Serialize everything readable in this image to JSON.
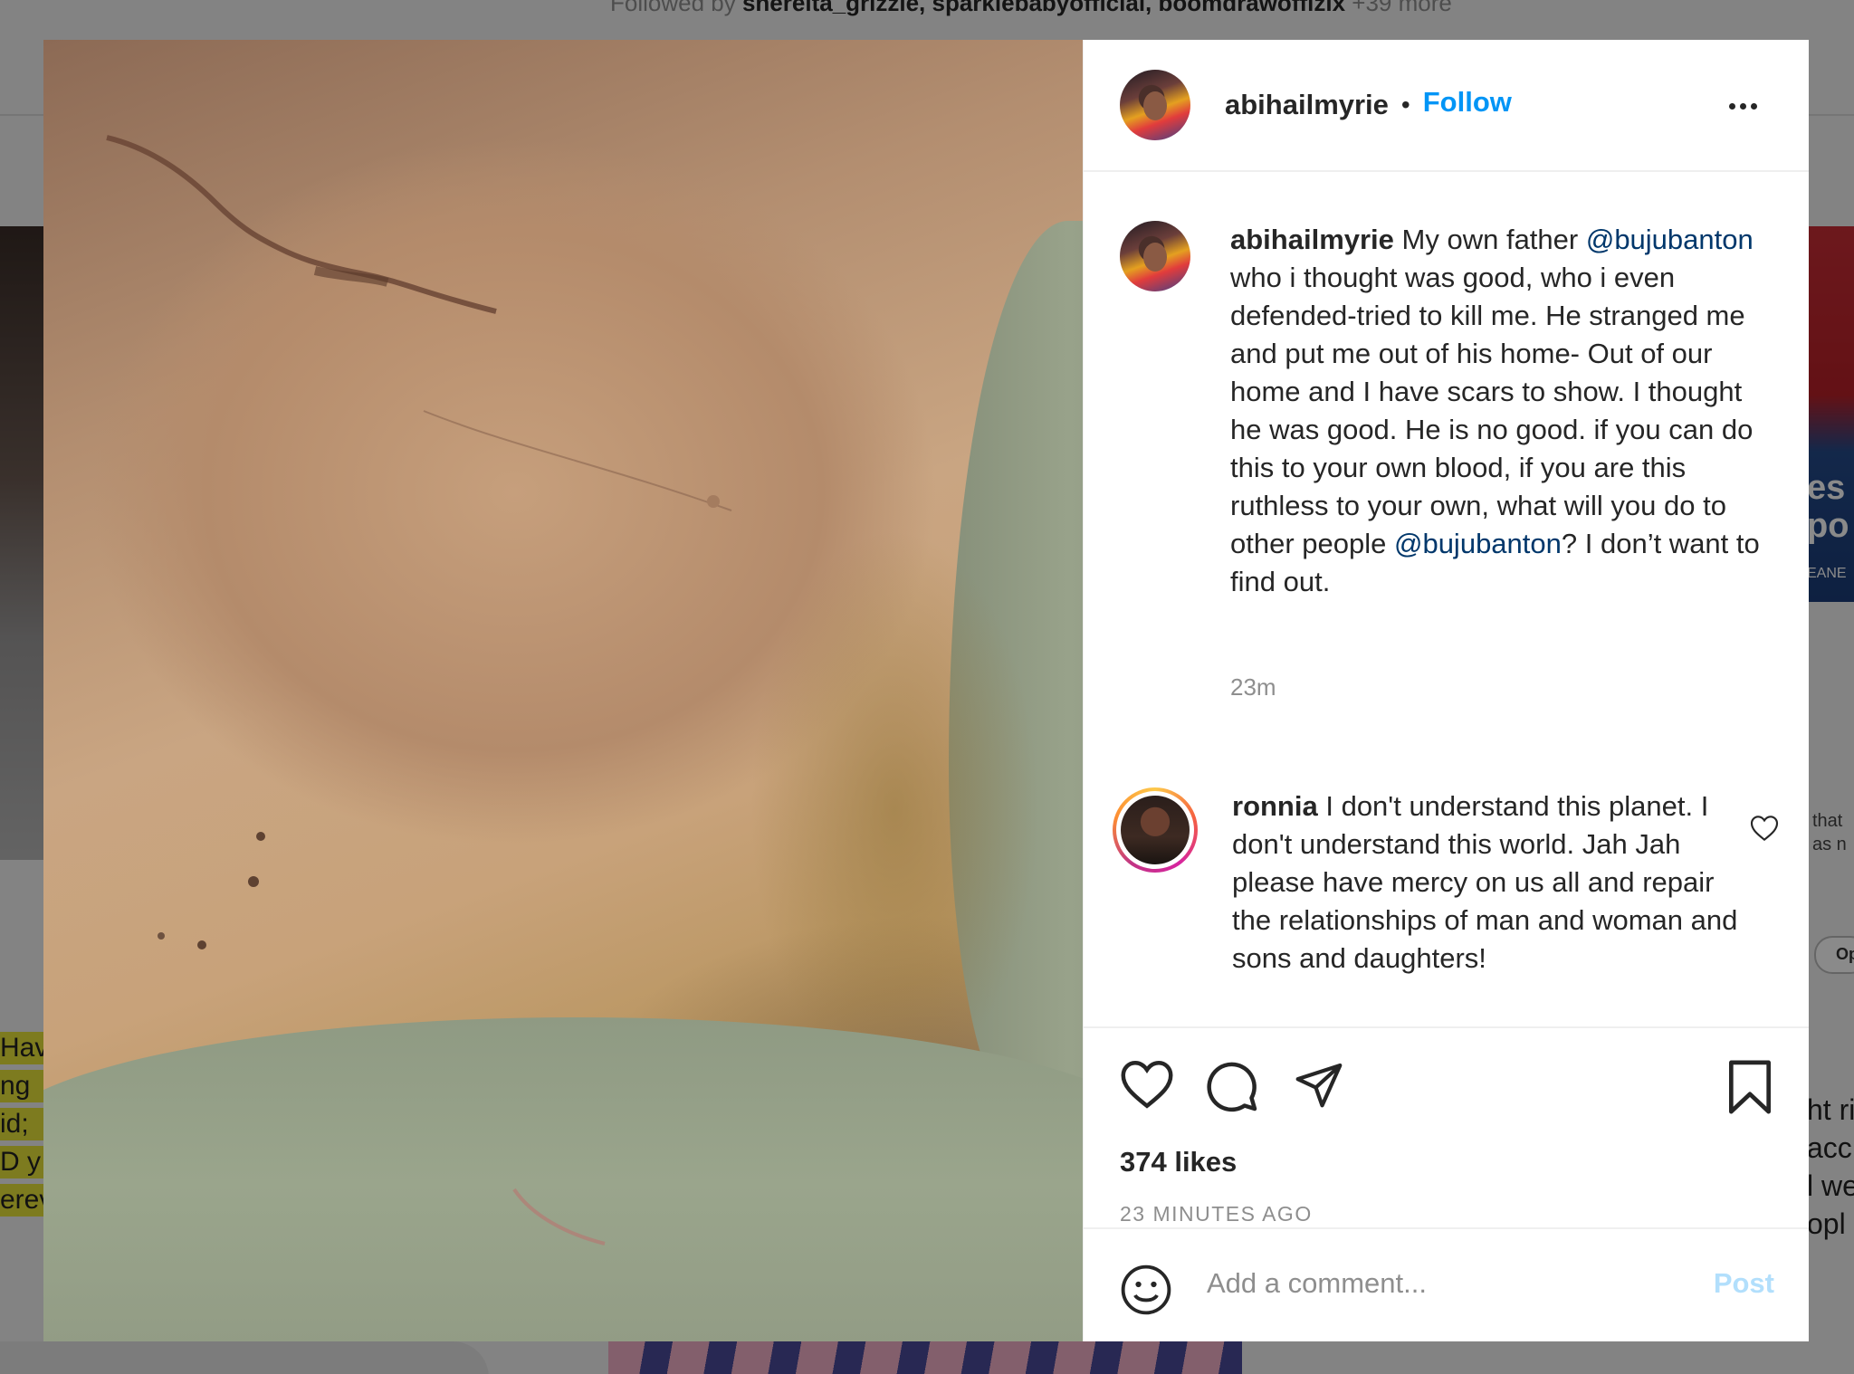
{
  "background": {
    "followed_by_prefix": "Followed by",
    "followed_by_names": "shereita_grizzle, sparklebabyofficial, boomdrawofflzix",
    "followed_by_more": "+39 more",
    "left_fragments": [
      "Hav",
      "ng",
      "id;",
      "D y",
      "erev"
    ],
    "right_card_fragments": [
      "es",
      "po",
      "EANE"
    ],
    "right_note_1": "that",
    "right_note_2": "as n",
    "right_pill": "Op",
    "right_lines": [
      "ht ri",
      "acc",
      "l we",
      "opl"
    ]
  },
  "post": {
    "author": "abihailmyrie",
    "follow_label": "Follow",
    "caption": {
      "author": "abihailmyrie",
      "part1": " My own father ",
      "mention1": "@bujubanton",
      "part2": " who i thought was good, who i even defended-tried to kill me. He stranged me and put me out of his home- Out of our home and I have scars to show. I thought he was good. He is no good. if you can do this to your own blood, if you are this ruthless to your own, what will you do to other people ",
      "mention2": "@bujubanton",
      "part3": "? I don’t want to find out."
    },
    "caption_time": "23m",
    "comments": [
      {
        "username": "ronnia",
        "text": " I don't understand this planet. I don't understand this world. Jah Jah please have mercy on us all and repair the relationships of man and woman and sons and daughters!"
      }
    ],
    "likes": "374 likes",
    "posted_ago": "23 MINUTES AGO",
    "add_comment_placeholder": "Add a comment...",
    "post_label": "Post"
  },
  "icons": {
    "like": "heart-icon",
    "comment": "comment-bubble-icon",
    "share": "paper-plane-icon",
    "save": "bookmark-icon",
    "emoji": "smiley-icon",
    "more": "more-options-icon"
  },
  "colors": {
    "accent": "#0095f6",
    "mention": "#00376b",
    "post_disabled": "#b2dffc",
    "muted_text": "#8e8e8e"
  }
}
